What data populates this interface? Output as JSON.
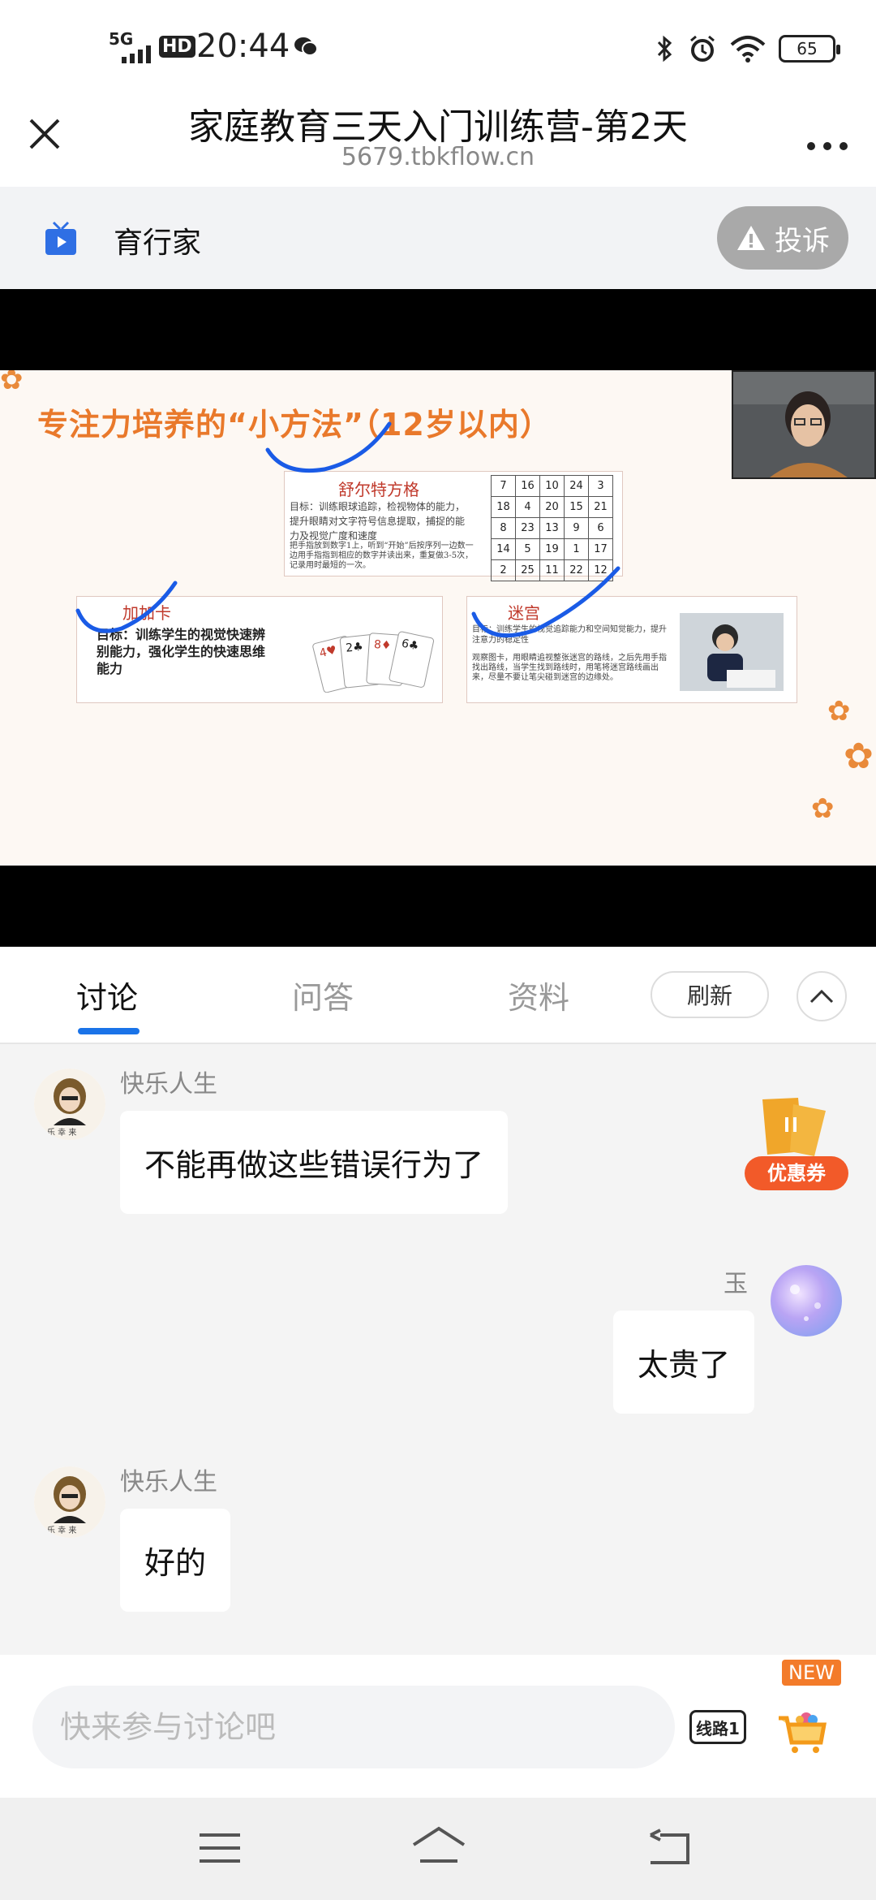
{
  "status_bar": {
    "network": "5G",
    "hd": "HD",
    "time": "20:44",
    "battery": "65"
  },
  "header": {
    "title": "家庭教育三天入门训练营-第2天",
    "domain": "5679.tbkflow.cn"
  },
  "channel": {
    "name": "育行家",
    "complain_label": "投诉"
  },
  "slide": {
    "title": "专注力培养的“小方法”（12岁以内）",
    "schulte": {
      "title": "舒尔特方格",
      "goal": "目标：训练眼球追踪，检视物体的能力，提升眼睛对文字符号信息提取，捕捉的能力及视觉广度和速度",
      "method": "把手指放到数字1上，听到“开始”后按序列一边数一边用手指指到相应的数字并读出来，重复做3-5次，记录用时最短的一次。",
      "grid": [
        [
          "7",
          "16",
          "10",
          "24",
          "3"
        ],
        [
          "18",
          "4",
          "20",
          "15",
          "21"
        ],
        [
          "8",
          "23",
          "13",
          "9",
          "6"
        ],
        [
          "14",
          "5",
          "19",
          "1",
          "17"
        ],
        [
          "2",
          "25",
          "11",
          "22",
          "12"
        ]
      ]
    },
    "cards": {
      "title": "加加卡",
      "goal": "目标：训练学生的视觉快速辨别能力，强化学生的快速思维能力"
    },
    "maze": {
      "title": "迷宫",
      "goal": "目标：训练学生的视觉追踪能力和空间知觉能力，提升注意力的稳定性",
      "method": "观察图卡，用眼睛追视整张迷宫的路线，之后先用手指找出路线，当学生找到路线时，用笔将迷宫路线画出来，尽量不要让笔尖碰到迷宫的边缘处。"
    }
  },
  "tabs": {
    "items": [
      "讨论",
      "问答",
      "资料"
    ],
    "refresh": "刷新"
  },
  "chat": {
    "messages": [
      {
        "user": "快乐人生",
        "text": "不能再做这些错误行为了",
        "side": "left"
      },
      {
        "user": "玉",
        "text": "太贵了",
        "side": "right"
      },
      {
        "user": "快乐人生",
        "text": "好的",
        "side": "left"
      }
    ],
    "coupon_label": "优惠券"
  },
  "input": {
    "placeholder": "快来参与讨论吧",
    "line_label": "线路1",
    "new_badge": "NEW"
  },
  "colors": {
    "accent": "#1a73e8",
    "slide_title": "#e9792b",
    "coupon": "#f25a29"
  }
}
